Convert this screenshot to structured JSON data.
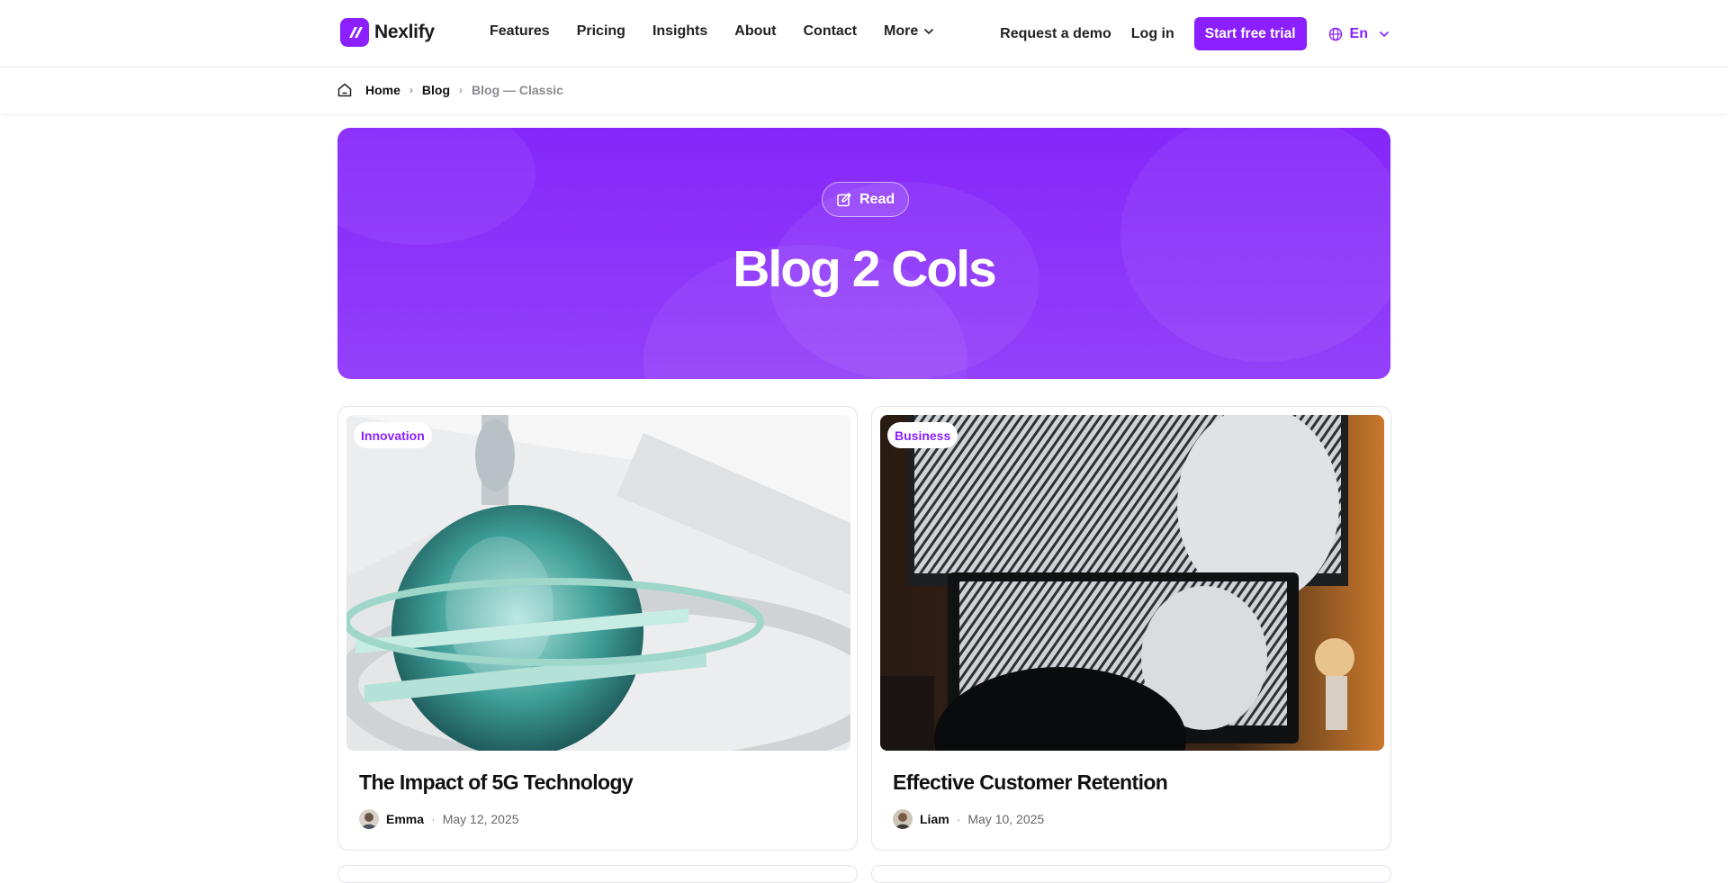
{
  "brand": {
    "name": "Nexlify",
    "accent": "#8b1fff"
  },
  "nav": {
    "items": [
      "Features",
      "Pricing",
      "Insights",
      "About",
      "Contact",
      "More"
    ]
  },
  "actions": {
    "demo": "Request a demo",
    "login": "Log in",
    "trial": "Start free trial",
    "language": "En"
  },
  "breadcrumb": {
    "items": [
      "Home",
      "Blog",
      "Blog — Classic"
    ]
  },
  "hero": {
    "pill": "Read",
    "title": "Blog 2 Cols"
  },
  "posts": [
    {
      "tag": "Innovation",
      "title": "The Impact of 5G Technology",
      "author": "Emma",
      "date": "May 12, 2025"
    },
    {
      "tag": "Business",
      "title": "Effective Customer Retention",
      "author": "Liam",
      "date": "May 10, 2025"
    }
  ],
  "icons": {
    "home": "home-icon",
    "globe": "globe-icon",
    "chevron": "chevron-down-icon",
    "edit": "edit-icon"
  }
}
